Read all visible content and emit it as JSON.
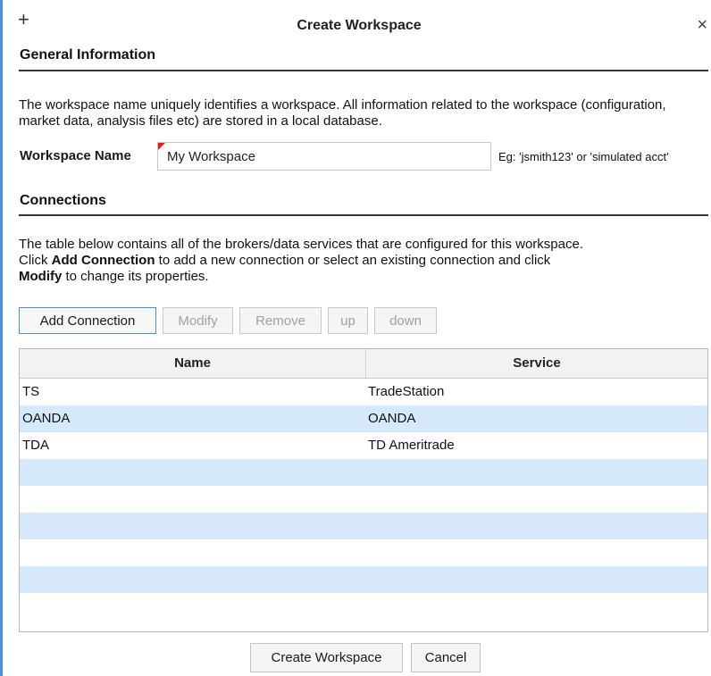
{
  "dialog": {
    "title": "Create Workspace",
    "add_glyph": "+",
    "close_glyph": "×"
  },
  "general": {
    "heading": "General Information",
    "description": "The workspace name uniquely identifies a workspace. All information related to the workspace (configuration, market data, analysis files etc) are stored in a local database.",
    "name_label": "Workspace Name",
    "name_value": "My Workspace",
    "name_hint": "Eg: 'jsmith123' or 'simulated acct'"
  },
  "connections": {
    "heading": "Connections",
    "description_1": "The table below contains all of the brokers/data services that are configured for this workspace.",
    "description_2_pre": "Click ",
    "description_2_bold": "Add Connection",
    "description_2_post": " to add a new connection or select an existing connection and click",
    "description_3_bold": "Modify",
    "description_3_post": " to change its properties.",
    "buttons": {
      "add": "Add Connection",
      "modify": "Modify",
      "remove": "Remove",
      "up": "up",
      "down": "down"
    },
    "table": {
      "columns": [
        "Name",
        "Service"
      ],
      "rows": [
        {
          "name": "TS",
          "service": "TradeStation"
        },
        {
          "name": "OANDA",
          "service": "OANDA"
        },
        {
          "name": "TDA",
          "service": "TD Ameritrade"
        }
      ]
    }
  },
  "footer": {
    "create_label": "Create Workspace",
    "cancel_label": "Cancel"
  },
  "colors": {
    "accent": "#4a90d9",
    "row_alt": "#d6e8fb",
    "required_flag": "#e02020"
  }
}
